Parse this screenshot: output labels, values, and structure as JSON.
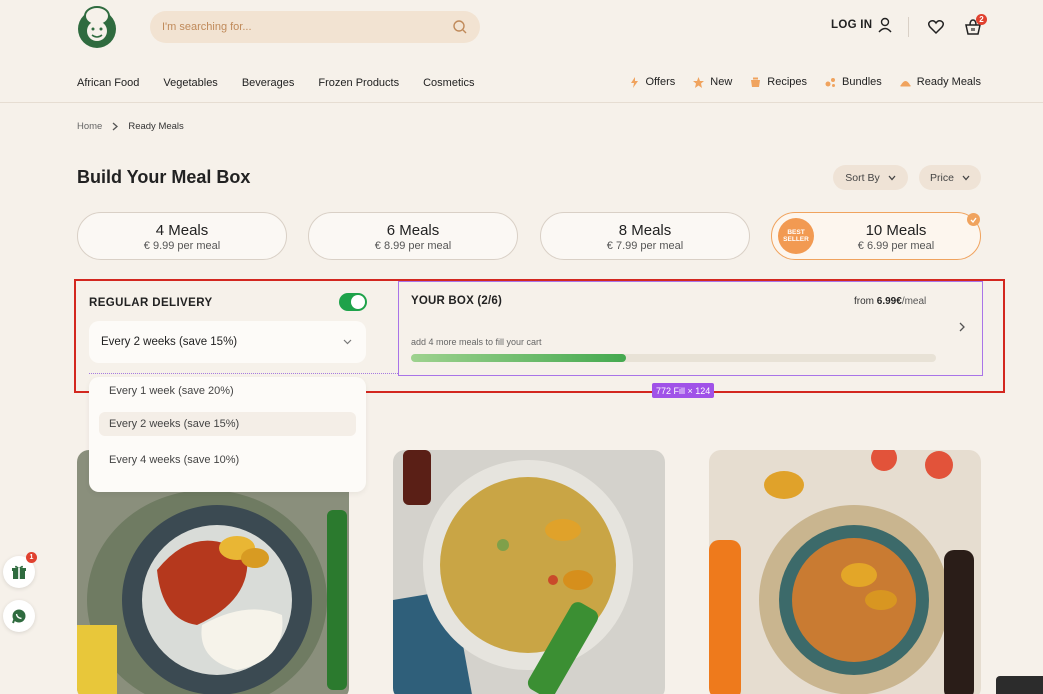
{
  "header": {
    "search_placeholder": "I'm searching for...",
    "login_label": "LOG IN",
    "cart_count": "2"
  },
  "nav": {
    "left": [
      "African Food",
      "Vegetables",
      "Beverages",
      "Frozen Products",
      "Cosmetics"
    ],
    "right": [
      {
        "label": "Offers",
        "icon": "bolt-icon",
        "color": "#f0a35e"
      },
      {
        "label": "New",
        "icon": "star-icon",
        "color": "#f0a35e"
      },
      {
        "label": "Recipes",
        "icon": "pot-icon",
        "color": "#f0a35e"
      },
      {
        "label": "Bundles",
        "icon": "bundle-icon",
        "color": "#f0a35e"
      },
      {
        "label": "Ready Meals",
        "icon": "dish-icon",
        "color": "#f0a35e"
      }
    ]
  },
  "breadcrumb": {
    "home": "Home",
    "current": "Ready Meals"
  },
  "page": {
    "title": "Build Your Meal Box",
    "sort_label": "Sort By",
    "price_label": "Price"
  },
  "plans": [
    {
      "title": "4 Meals",
      "price": "€ 9.99 per meal",
      "selected": false
    },
    {
      "title": "6 Meals",
      "price": "€ 8.99 per meal",
      "selected": false
    },
    {
      "title": "8 Meals",
      "price": "€ 7.99 per meal",
      "selected": false
    },
    {
      "title": "10 Meals",
      "price": "€ 6.99 per meal",
      "selected": true,
      "badge_line1": "BEST",
      "badge_line2": "SELLER"
    }
  ],
  "delivery": {
    "label": "REGULAR DELIVERY",
    "enabled": true,
    "selected": "Every 2 weeks (save 15%)",
    "options": [
      "Every 1 week (save 20%)",
      "Every 2 weeks (save 15%)",
      "Every 4 weeks (save 10%)"
    ]
  },
  "box": {
    "title": "YOUR BOX (2/6)",
    "from_prefix": "from",
    "from_price": "6.99€",
    "from_unit": "/meal",
    "hint": "add 4 more meals to fill your cart",
    "progress": 0.41
  },
  "design_tag": "772 Fill × 124",
  "floating": {
    "gift_count": "1"
  },
  "colors": {
    "accent": "#f0a35e",
    "green": "#1ea24a",
    "highlight": "#d3271f",
    "selection": "#a974e8"
  }
}
